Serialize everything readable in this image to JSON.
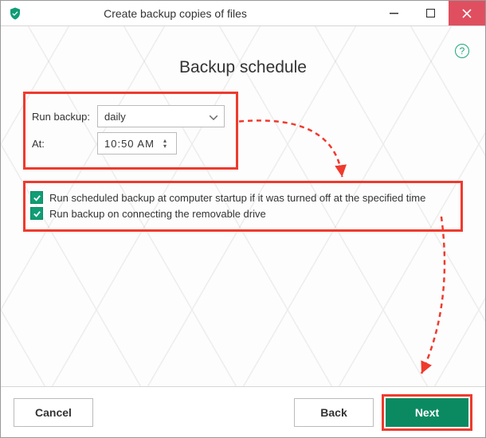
{
  "window": {
    "title": "Create backup copies of files"
  },
  "page": {
    "title": "Backup schedule"
  },
  "schedule": {
    "run_label": "Run backup:",
    "frequency": "daily",
    "at_label": "At:",
    "time": "10:50  AM"
  },
  "checks": {
    "startup": "Run scheduled backup at computer startup if it was turned off at the specified time",
    "removable": "Run backup on connecting the removable drive"
  },
  "buttons": {
    "cancel": "Cancel",
    "back": "Back",
    "next": "Next"
  },
  "colors": {
    "accent": "#0b8a62",
    "highlight": "#ef3a2d",
    "close": "#e04f5f"
  }
}
